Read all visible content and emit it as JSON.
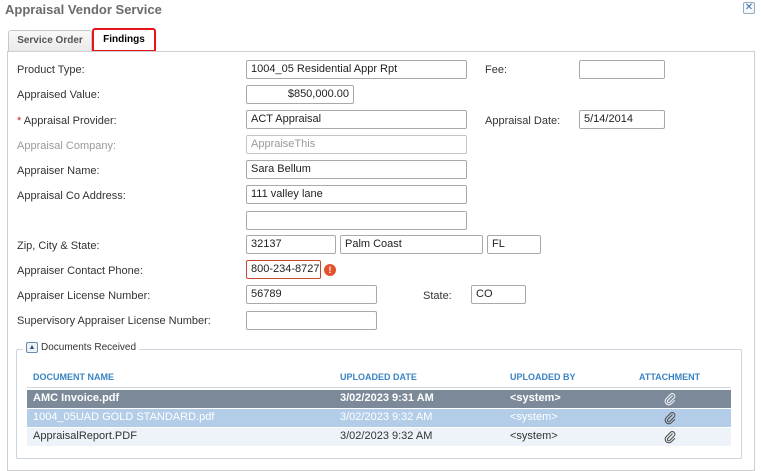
{
  "window": {
    "title": "Appraisal Vendor Service"
  },
  "tabs": [
    {
      "label": "Service Order"
    },
    {
      "label": "Findings"
    }
  ],
  "form": {
    "product_type_label": "Product Type:",
    "product_type_value": "1004_05 Residential Appr Rpt",
    "fee_label": "Fee:",
    "fee_value": "",
    "appraised_value_label": "Appraised Value:",
    "appraised_value": "$850,000.00",
    "required_mark": "*",
    "appraisal_provider_label": "Appraisal Provider:",
    "appraisal_provider_value": "ACT Appraisal",
    "appraisal_date_label": "Appraisal Date:",
    "appraisal_date_value": "5/14/2014",
    "appraisal_company_label": "Appraisal Company:",
    "appraisal_company_value": "AppraiseThis",
    "appraiser_name_label": "Appraiser Name:",
    "appraiser_name_value": "Sara Bellum",
    "address_label": "Appraisal Co Address:",
    "address_line1": "111 valley lane",
    "address_line2": "",
    "zip_city_state_label": "Zip, City & State:",
    "zip": "32137",
    "city": "Palm Coast",
    "state_code": "FL",
    "contact_phone_label": "Appraiser Contact Phone:",
    "contact_phone_value": "800-234-8727",
    "error_glyph": "!",
    "license_label": "Appraiser License Number:",
    "license_value": "56789",
    "license_state_label": "State:",
    "license_state_value": "CO",
    "supervisory_label": "Supervisory Appraiser License Number:",
    "supervisory_value": ""
  },
  "documents": {
    "legend": "Documents Received",
    "collapse_glyph": "▲",
    "columns": [
      "DOCUMENT NAME",
      "UPLOADED DATE",
      "UPLOADED BY",
      "ATTACHMENT"
    ],
    "rows": [
      {
        "name": "AMC Invoice.pdf",
        "date": "3/02/2023 9:31 AM",
        "by": "<system>",
        "icon": "paperclip-icon"
      },
      {
        "name": "1004_05UAD GOLD STANDARD.pdf",
        "date": "3/02/2023 9:32 AM",
        "by": "<system>",
        "icon": "paperclip-icon"
      },
      {
        "name": "AppraisalReport.PDF",
        "date": "3/02/2023 9:32 AM",
        "by": "<system>",
        "icon": "paperclip-icon"
      }
    ]
  },
  "colors": {
    "selected_tab_border": "#e8141b",
    "header_text": "#3a84c4",
    "row_selected": "#7b8998",
    "row_hover": "#b3cde8",
    "error": "#e4512c"
  }
}
